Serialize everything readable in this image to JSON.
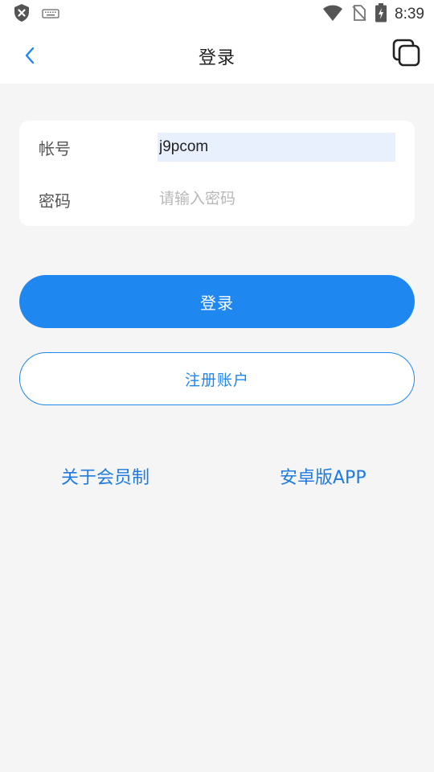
{
  "statusbar": {
    "time": "8:39",
    "icons": [
      "shield-x-icon",
      "keyboard-icon",
      "wifi-icon",
      "no-sim-icon",
      "battery-charging-icon"
    ]
  },
  "appbar": {
    "title": "登录",
    "back_icon": "chevron-left-icon",
    "action_icon": "multi-window-icon"
  },
  "form": {
    "account_label": "帐号",
    "account_value": "j9pcom",
    "password_label": "密码",
    "password_placeholder": "请输入密码"
  },
  "buttons": {
    "login": "登录",
    "register": "注册账户"
  },
  "links": {
    "about_membership": "关于会员制",
    "android_app": "安卓版APP"
  },
  "colors": {
    "accent": "#1f87f0",
    "background": "#f5f5f5",
    "autofill": "#e8f0fe"
  }
}
